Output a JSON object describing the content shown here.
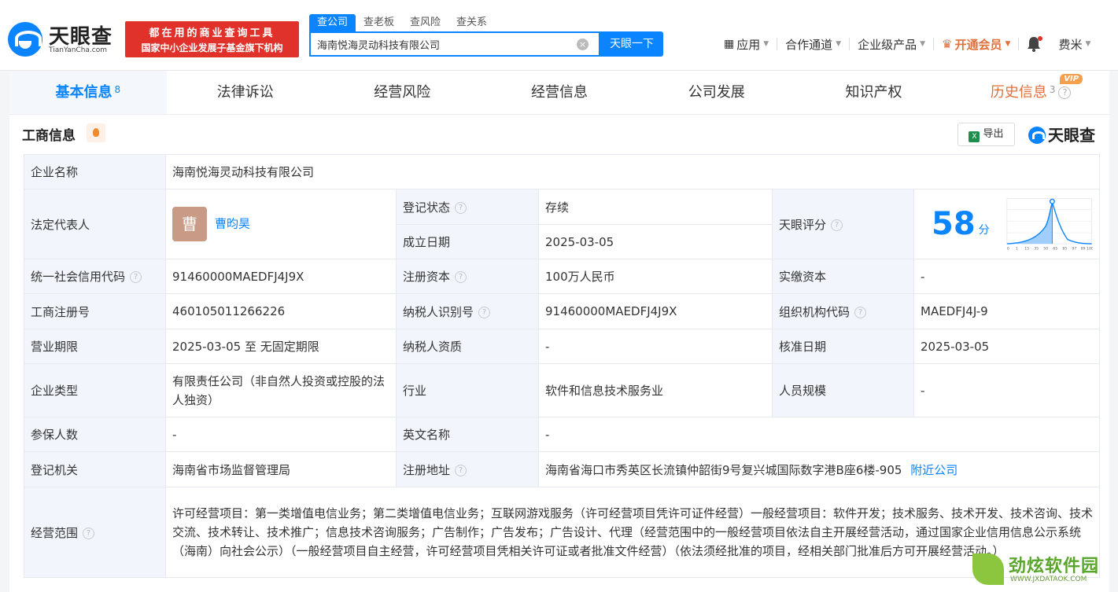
{
  "header": {
    "logo_cn": "天眼查",
    "logo_en": "TianYanCha.com",
    "slogan_line1": "都在用的商业查询工具",
    "slogan_line2": "国家中小企业发展子基金旗下机构",
    "search_tabs": [
      "查公司",
      "查老板",
      "查风险",
      "查关系"
    ],
    "search_value": "海南悦海灵动科技有限公司",
    "search_button": "天眼一下",
    "nav": {
      "apps": "应用",
      "channel": "合作通道",
      "enterprise": "企业级产品",
      "vip": "开通会员",
      "user": "费米"
    }
  },
  "tabs": [
    {
      "label": "基本信息",
      "count": "8"
    },
    {
      "label": "法律诉讼"
    },
    {
      "label": "经营风险"
    },
    {
      "label": "经营信息"
    },
    {
      "label": "公司发展"
    },
    {
      "label": "知识产权"
    },
    {
      "label": "历史信息",
      "count": "3",
      "badge": "VIP"
    }
  ],
  "panel": {
    "title": "工商信息",
    "export": "导出",
    "brand": "天眼查"
  },
  "info": {
    "company_name_label": "企业名称",
    "company_name": "海南悦海灵动科技有限公司",
    "legal_rep_label": "法定代表人",
    "legal_rep_avatar": "曹",
    "legal_rep": "曹昀昊",
    "reg_status_label": "登记状态",
    "reg_status": "存续",
    "found_date_label": "成立日期",
    "found_date": "2025-03-05",
    "score_label": "天眼评分",
    "score": "58",
    "score_unit": "分",
    "score_axis": [
      "0",
      "1",
      "15",
      "35",
      "50",
      "65",
      "85",
      "97",
      "99",
      "100"
    ],
    "credit_code_label": "统一社会信用代码",
    "credit_code": "91460000MAEDFJ4J9X",
    "reg_capital_label": "注册资本",
    "reg_capital": "100万人民币",
    "paid_capital_label": "实缴资本",
    "paid_capital": "-",
    "reg_no_label": "工商注册号",
    "reg_no": "460105011266226",
    "taxpayer_id_label": "纳税人识别号",
    "taxpayer_id": "91460000MAEDFJ4J9X",
    "org_code_label": "组织机构代码",
    "org_code": "MAEDFJ4J-9",
    "term_label": "营业期限",
    "term": "2025-03-05 至 无固定期限",
    "taxpayer_qual_label": "纳税人资质",
    "taxpayer_qual": "-",
    "approve_date_label": "核准日期",
    "approve_date": "2025-03-05",
    "company_type_label": "企业类型",
    "company_type": "有限责任公司（非自然人投资或控股的法人独资）",
    "industry_label": "行业",
    "industry": "软件和信息技术服务业",
    "staff_size_label": "人员规模",
    "staff_size": "-",
    "insured_label": "参保人数",
    "insured": "-",
    "english_name_label": "英文名称",
    "english_name": "-",
    "authority_label": "登记机关",
    "authority": "海南省市场监督管理局",
    "address_label": "注册地址",
    "address": "海南省海口市秀英区长流镇仲韶街9号复兴城国际数字港B座6楼-905",
    "nearby": "附近公司",
    "scope_label": "经营范围",
    "scope": "许可经营项目：第一类增值电信业务；第二类增值电信业务；互联网游戏服务（许可经营项目凭许可证件经营）一般经营项目：软件开发；技术服务、技术开发、技术咨询、技术交流、技术转让、技术推广；信息技术咨询服务；广告制作；广告发布；广告设计、代理（经营范围中的一般经营项目依法自主开展经营活动，通过国家企业信用信息公示系统（海南）向社会公示）（一般经营项目自主经营，许可经营项目凭相关许可证或者批准文件经营）（依法须经批准的项目，经相关部门批准后方可开展经营活动。）"
  },
  "watermark": {
    "text": "劲炫软件园",
    "url": "WWW.JXDATAOK.COM"
  }
}
